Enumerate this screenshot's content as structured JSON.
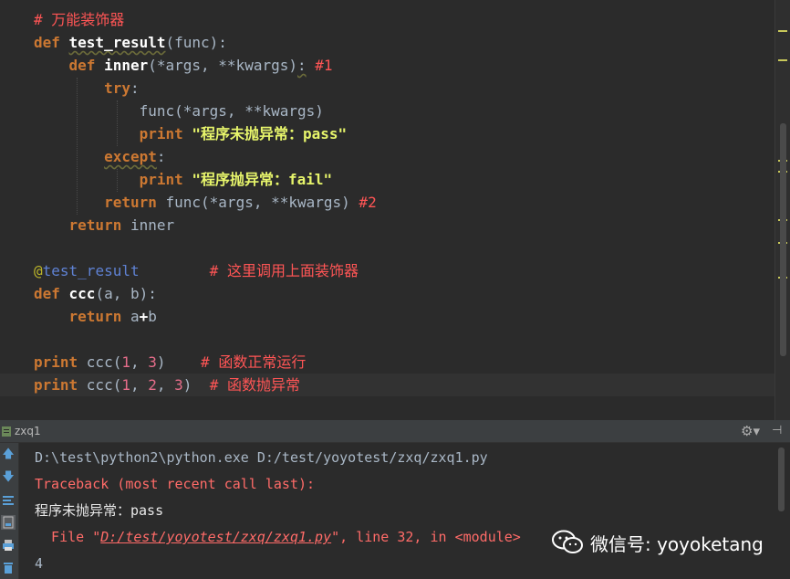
{
  "editor": {
    "lines": [
      {
        "id": "l1",
        "segments": [
          {
            "c": "cm",
            "t": "# 万能装饰器"
          }
        ]
      },
      {
        "id": "l2",
        "segments": [
          {
            "c": "kw",
            "t": "def "
          },
          {
            "c": "fnw wavy",
            "t": "test_result"
          },
          {
            "c": "plain",
            "t": "(func):"
          }
        ]
      },
      {
        "id": "l3",
        "segments": [
          {
            "c": "plain",
            "t": "    "
          },
          {
            "c": "kw",
            "t": "def "
          },
          {
            "c": "fnw",
            "t": "inner"
          },
          {
            "c": "plain",
            "t": "(*args, **kwargs)"
          },
          {
            "c": "plain wavy",
            "t": ":"
          },
          {
            "c": "cm",
            "t": " #1"
          }
        ]
      },
      {
        "id": "l4",
        "segments": [
          {
            "c": "plain",
            "t": "        "
          },
          {
            "c": "kw",
            "t": "try"
          },
          {
            "c": "plain",
            "t": ":"
          }
        ]
      },
      {
        "id": "l5",
        "segments": [
          {
            "c": "plain",
            "t": "            func(*args, **kwargs)"
          }
        ]
      },
      {
        "id": "l6",
        "segments": [
          {
            "c": "plain",
            "t": "            "
          },
          {
            "c": "kw",
            "t": "print "
          },
          {
            "c": "str",
            "t": "\"程序未抛异常：pass\""
          }
        ]
      },
      {
        "id": "l7",
        "segments": [
          {
            "c": "plain",
            "t": "        "
          },
          {
            "c": "kw wavy",
            "t": "except"
          },
          {
            "c": "plain",
            "t": ":"
          }
        ]
      },
      {
        "id": "l8",
        "segments": [
          {
            "c": "plain",
            "t": "            "
          },
          {
            "c": "kw",
            "t": "print "
          },
          {
            "c": "str",
            "t": "\"程序抛异常：fail\""
          }
        ]
      },
      {
        "id": "l9",
        "segments": [
          {
            "c": "plain",
            "t": "        "
          },
          {
            "c": "kw",
            "t": "return "
          },
          {
            "c": "plain",
            "t": "func(*args, **kwargs)"
          },
          {
            "c": "cm",
            "t": " #2"
          }
        ]
      },
      {
        "id": "l10",
        "segments": [
          {
            "c": "plain",
            "t": "    "
          },
          {
            "c": "kw",
            "t": "return "
          },
          {
            "c": "plain",
            "t": "inner"
          }
        ]
      },
      {
        "id": "l11",
        "segments": []
      },
      {
        "id": "l12",
        "segments": [
          {
            "c": "dec",
            "t": "@"
          },
          {
            "c": "decname",
            "t": "test_result"
          },
          {
            "c": "plain",
            "t": "        "
          },
          {
            "c": "cm",
            "t": "# 这里调用上面装饰器"
          }
        ]
      },
      {
        "id": "l13",
        "segments": [
          {
            "c": "kw",
            "t": "def "
          },
          {
            "c": "fnw",
            "t": "ccc"
          },
          {
            "c": "plain",
            "t": "(a, b):"
          }
        ]
      },
      {
        "id": "l14",
        "segments": [
          {
            "c": "plain",
            "t": "    "
          },
          {
            "c": "kw",
            "t": "return "
          },
          {
            "c": "plain",
            "t": "a"
          },
          {
            "c": "op",
            "t": "+"
          },
          {
            "c": "plain",
            "t": "b"
          }
        ]
      },
      {
        "id": "l15",
        "segments": []
      },
      {
        "id": "l16",
        "segments": [
          {
            "c": "kw",
            "t": "print "
          },
          {
            "c": "plain",
            "t": "ccc("
          },
          {
            "c": "num",
            "t": "1"
          },
          {
            "c": "plain",
            "t": ", "
          },
          {
            "c": "num",
            "t": "3"
          },
          {
            "c": "plain",
            "t": ")    "
          },
          {
            "c": "cm",
            "t": "# 函数正常运行"
          }
        ]
      },
      {
        "id": "l17",
        "segments": [
          {
            "c": "kw",
            "t": "print "
          },
          {
            "c": "plain",
            "t": "ccc("
          },
          {
            "c": "num",
            "t": "1"
          },
          {
            "c": "plain",
            "t": ", "
          },
          {
            "c": "num",
            "t": "2"
          },
          {
            "c": "plain",
            "t": ", "
          },
          {
            "c": "num",
            "t": "3"
          },
          {
            "c": "plain",
            "t": ")  "
          },
          {
            "c": "cm",
            "t": "# 函数抛异常"
          }
        ]
      }
    ]
  },
  "run_panel": {
    "tab_label": "zxq1",
    "console_lines": [
      {
        "c": "con-plain",
        "t": "D:\\test\\python2\\python.exe D:/test/yoyotest/zxq/zxq1.py"
      },
      {
        "c": "con-err",
        "t": "Traceback (most recent call last):"
      },
      {
        "c": "con-cn",
        "t": "程序未抛异常：pass"
      },
      {
        "c": "con-err",
        "t": "  File \"",
        "link": "D:/test/yoyotest/zxq/zxq1.py",
        "tail": "\", line 32, in <module>"
      },
      {
        "c": "con-plain",
        "t": "4"
      }
    ]
  },
  "watermark": {
    "text": "微信号: yoyoketang"
  },
  "colors": {
    "background": "#2b2b2b",
    "keyword": "#cc7832",
    "comment": "#ff5555",
    "string": "#e7f56b",
    "number": "#e66d8a"
  },
  "icons": {
    "gear": "gear-icon",
    "pin": "pin-icon",
    "up": "arrow-up-icon",
    "down": "arrow-down-icon",
    "wrap": "soft-wrap-icon",
    "scroll_end": "scroll-to-end-icon",
    "print": "print-icon",
    "trash": "trash-icon",
    "wechat": "wechat-icon"
  }
}
